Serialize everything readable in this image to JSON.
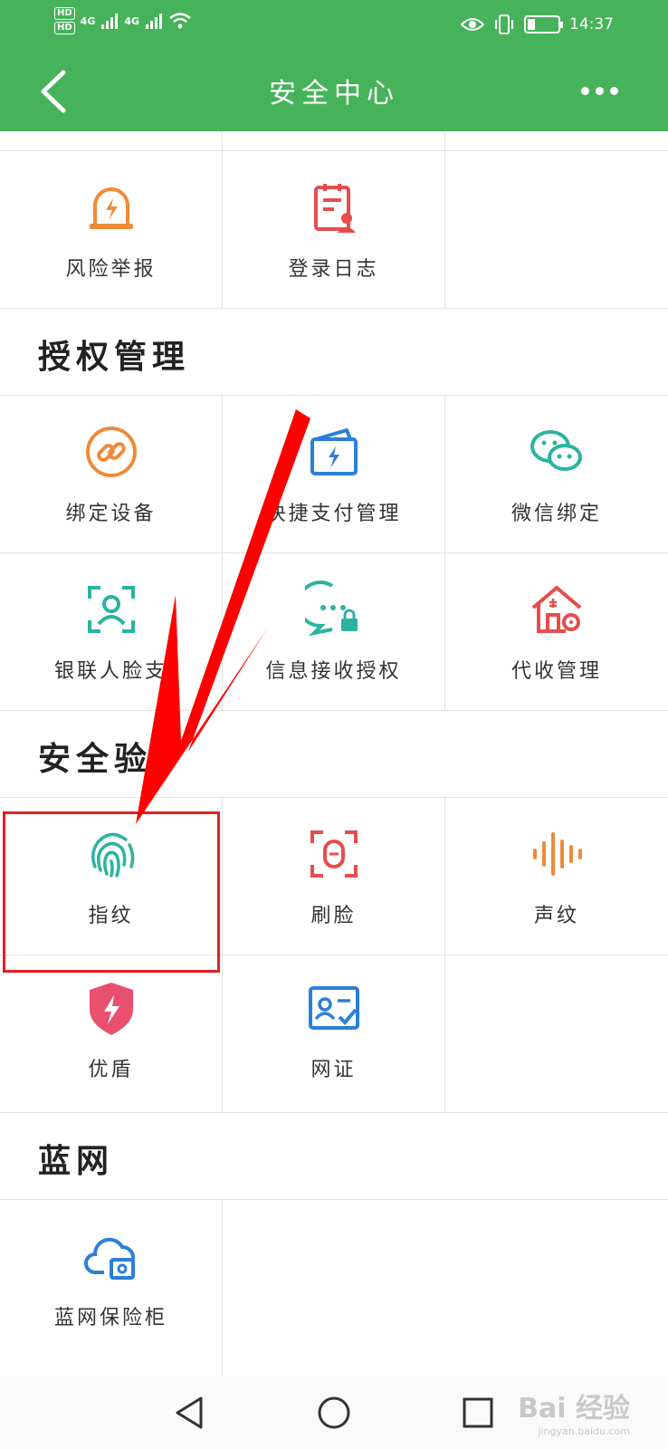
{
  "status_bar": {
    "sim1": "HD",
    "sim2": "HD",
    "network1": "4G",
    "network2": "4G",
    "battery_level": "23",
    "time": "14:37"
  },
  "header": {
    "title": "安全中心"
  },
  "rows": {
    "top": [
      "风险举报",
      "登录日志",
      ""
    ],
    "auth1": [
      "绑定设备",
      "快捷支付管理",
      "微信绑定"
    ],
    "auth2": [
      "银联人脸支",
      "信息接收授权",
      "代收管理"
    ],
    "verify1": [
      "指纹",
      "刷脸",
      "声纹"
    ],
    "verify2": [
      "优盾",
      "网证",
      ""
    ],
    "blue": [
      "蓝网保险柜",
      "",
      ""
    ]
  },
  "sections": {
    "auth": "授权管理",
    "verify": "安全验",
    "blue": "蓝网"
  },
  "watermark": {
    "brand": "Bai 经验",
    "domain": "jingyan.baidu.com"
  },
  "colors": {
    "header_green": "#46b35a",
    "highlight_red": "#e42020",
    "arrow_red": "#ff0000"
  }
}
